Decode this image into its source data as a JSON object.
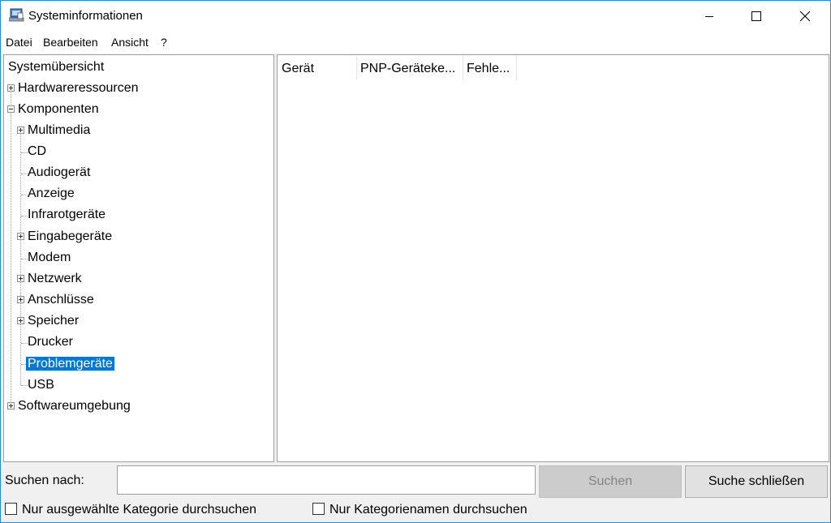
{
  "window": {
    "title": "Systeminformationen"
  },
  "menu": {
    "items": [
      "Datei",
      "Bearbeiten",
      "Ansicht",
      "?"
    ]
  },
  "tree": {
    "items": [
      {
        "label": "Systemübersicht",
        "expander": "none"
      },
      {
        "label": "Hardwareressourcen",
        "expander": "plus"
      },
      {
        "label": "Komponenten",
        "expander": "minus"
      },
      {
        "label": "Multimedia",
        "expander": "plus"
      },
      {
        "label": "CD",
        "expander": "none"
      },
      {
        "label": "Audiogerät",
        "expander": "none"
      },
      {
        "label": "Anzeige",
        "expander": "none"
      },
      {
        "label": "Infrarotgeräte",
        "expander": "none"
      },
      {
        "label": "Eingabegeräte",
        "expander": "plus"
      },
      {
        "label": "Modem",
        "expander": "none"
      },
      {
        "label": "Netzwerk",
        "expander": "plus"
      },
      {
        "label": "Anschlüsse",
        "expander": "plus"
      },
      {
        "label": "Speicher",
        "expander": "plus"
      },
      {
        "label": "Drucker",
        "expander": "none"
      },
      {
        "label": "Problemgeräte",
        "expander": "none",
        "selected": true
      },
      {
        "label": "USB",
        "expander": "none"
      },
      {
        "label": "Softwareumgebung",
        "expander": "plus"
      }
    ]
  },
  "list": {
    "columns": [
      "Gerät",
      "PNP-Geräteke...",
      "Fehle..."
    ]
  },
  "search": {
    "label": "Suchen nach:",
    "value": "",
    "search_button": "Suchen",
    "close_button": "Suche schließen",
    "search_button_enabled": false
  },
  "options": {
    "only_selected_category": {
      "label": "Nur ausgewählte Kategorie durchsuchen",
      "checked": false
    },
    "only_category_names": {
      "label": "Nur Kategorienamen durchsuchen",
      "checked": false
    }
  },
  "colors": {
    "accent": "#0078d7",
    "window_border": "#1c8ee6",
    "disabled_button": "#cccccc"
  }
}
